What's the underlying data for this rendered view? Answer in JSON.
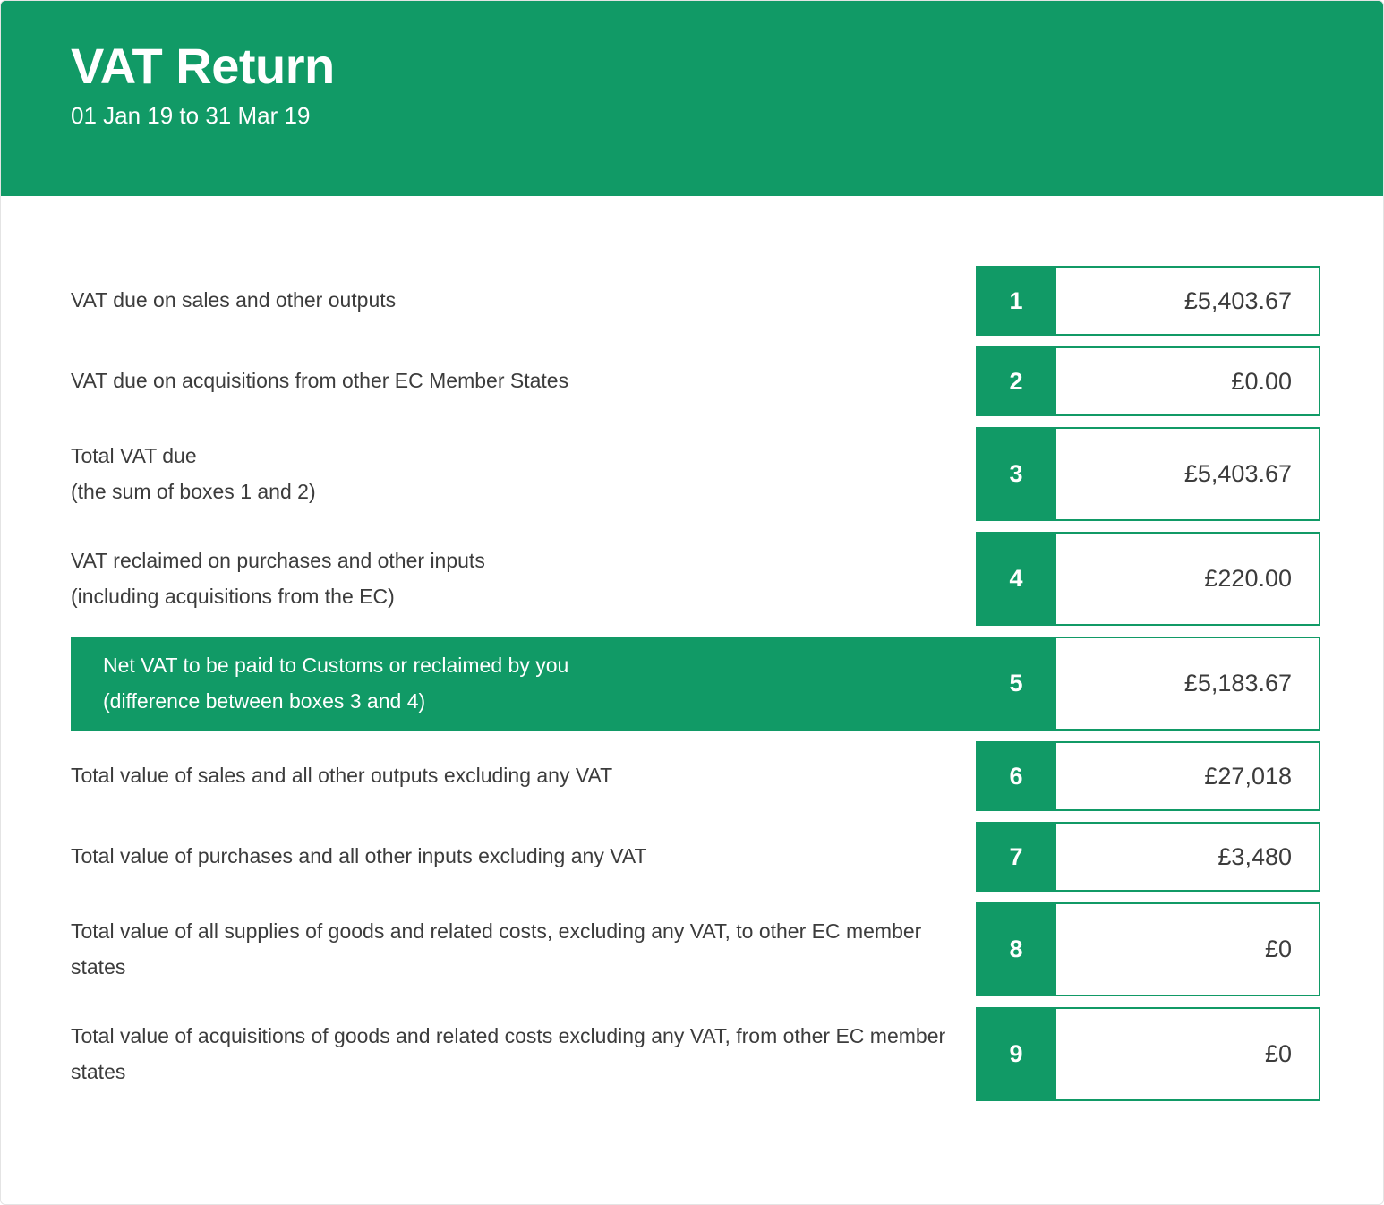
{
  "header": {
    "title": "VAT Return",
    "period": "01 Jan 19 to 31 Mar 19"
  },
  "colors": {
    "brand_green": "#119a66",
    "label_text": "#3c3c3c",
    "page_background": "#ffffff"
  },
  "rows": [
    {
      "number": "1",
      "label": "VAT due on sales and other outputs",
      "sublabel": "",
      "value": "£5,403.67",
      "highlighted": false,
      "size": "short"
    },
    {
      "number": "2",
      "label": "VAT due on acquisitions from other EC Member States",
      "sublabel": "",
      "value": "£0.00",
      "highlighted": false,
      "size": "short"
    },
    {
      "number": "3",
      "label": "Total VAT due",
      "sublabel": "(the sum of boxes 1 and 2)",
      "value": "£5,403.67",
      "highlighted": false,
      "size": "tall"
    },
    {
      "number": "4",
      "label": "VAT reclaimed on purchases and other inputs",
      "sublabel": "(including acquisitions from the EC)",
      "value": "£220.00",
      "highlighted": false,
      "size": "tall"
    },
    {
      "number": "5",
      "label": "Net VAT to be paid to Customs or reclaimed by you",
      "sublabel": "(difference between boxes 3 and 4)",
      "value": "£5,183.67",
      "highlighted": true,
      "size": "tall"
    },
    {
      "number": "6",
      "label": "Total value of sales and all other outputs excluding any VAT",
      "sublabel": "",
      "value": "£27,018",
      "highlighted": false,
      "size": "short"
    },
    {
      "number": "7",
      "label": "Total value of purchases and all other inputs excluding any VAT",
      "sublabel": "",
      "value": "£3,480",
      "highlighted": false,
      "size": "short"
    },
    {
      "number": "8",
      "label": "Total value of all supplies of goods and related costs, excluding any VAT, to other EC member states",
      "sublabel": "",
      "value": "£0",
      "highlighted": false,
      "size": "tall"
    },
    {
      "number": "9",
      "label": "Total value of acquisitions of goods and related costs excluding any VAT, from other EC member states",
      "sublabel": "",
      "value": "£0",
      "highlighted": false,
      "size": "tall"
    }
  ]
}
